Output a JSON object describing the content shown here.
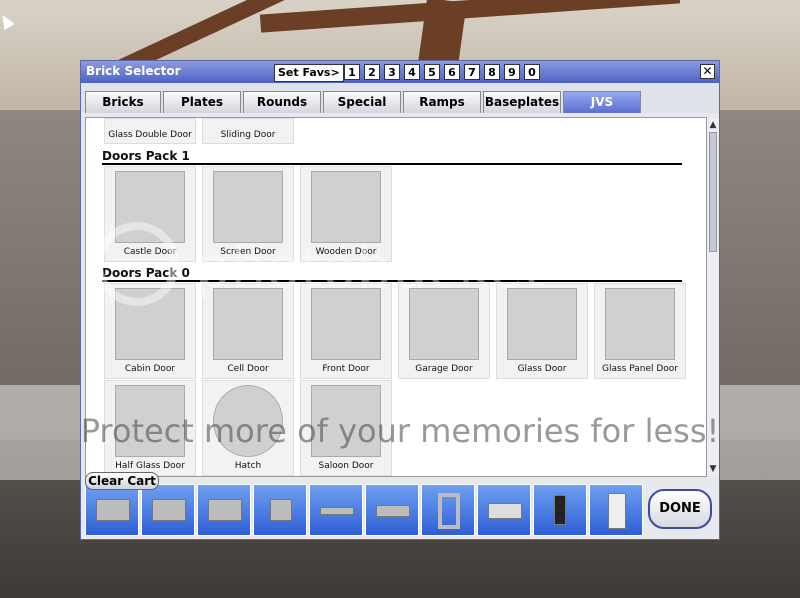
{
  "window": {
    "title": "Brick Selector",
    "set_favs_label": "Set Favs>",
    "fav_slots": [
      "1",
      "2",
      "3",
      "4",
      "5",
      "6",
      "7",
      "8",
      "9",
      "0"
    ],
    "close_glyph": "✕"
  },
  "tabs": [
    "Bricks",
    "Plates",
    "Rounds",
    "Special",
    "Ramps",
    "Baseplates",
    "JVS"
  ],
  "active_tab": "JVS",
  "top_row": [
    {
      "label": "Glass Double Door"
    },
    {
      "label": "Sliding Door"
    }
  ],
  "sections": [
    {
      "header": "Doors Pack 1",
      "items": [
        {
          "label": "Castle Door"
        },
        {
          "label": "Screen Door"
        },
        {
          "label": "Wooden Door"
        }
      ]
    },
    {
      "header": "Doors Pack 0",
      "items": [
        {
          "label": "Cabin Door"
        },
        {
          "label": "Cell Door"
        },
        {
          "label": "Front Door"
        },
        {
          "label": "Garage Door"
        },
        {
          "label": "Glass Door"
        },
        {
          "label": "Glass Panel Door"
        },
        {
          "label": "Half Glass Door"
        },
        {
          "label": "Hatch"
        },
        {
          "label": "Saloon Door"
        }
      ]
    }
  ],
  "buttons": {
    "clear_cart": "Clear Cart",
    "done": "DONE"
  },
  "scrollbar": {
    "up": "▲",
    "down": "▼"
  },
  "watermark": {
    "tagline": "Protect more of your memories for less!",
    "logo": "photobucket"
  },
  "cart_slots": [
    "brick",
    "brick",
    "brick",
    "cube",
    "bar",
    "plate",
    "frame",
    "ramp",
    "wheel",
    "door"
  ]
}
